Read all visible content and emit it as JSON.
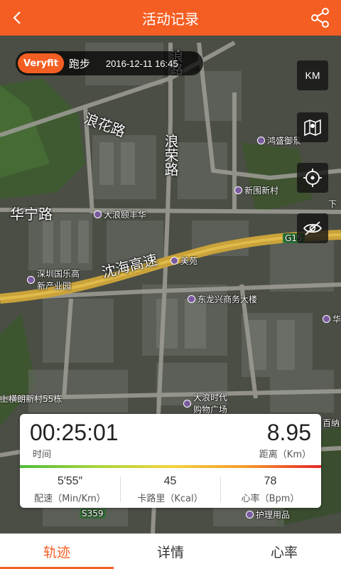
{
  "header": {
    "title": "活动记录",
    "back_icon": "back-arrow-icon",
    "share_icon": "share-icon"
  },
  "activity": {
    "brand": "Veryfit",
    "sport": "跑步",
    "datetime": "2016-12-11  16:45"
  },
  "controls": {
    "unit_label": "KM",
    "icons": [
      "map-type-icon",
      "locate-icon",
      "hide-icon"
    ]
  },
  "map": {
    "labels": {
      "road_langhua": "浪花路",
      "road_langrong": "浪荣路",
      "road_lang_top": "浪路",
      "road_huaning": "华宁路",
      "expressway": "沈海高速",
      "g15": "G15",
      "s359": "S359"
    },
    "pois": {
      "dalang_fenghua": "大浪颐丰华",
      "meiyuan": "美苑",
      "donglongxing": "东龙兴商务大楼",
      "hongsheng": "鸿盛御景",
      "xinguocun": "新围新村",
      "shenzhen_guole": "深圳国乐高新产业园",
      "shangheng": "上横朗新村55栋",
      "dalang_shidai": "大浪时代购物广场",
      "baiyou": "百纳",
      "hua": "华",
      "huli": "护理用品",
      "xia": "下"
    }
  },
  "stats": {
    "duration": "00:25:01",
    "duration_label": "时间",
    "distance": "8.95",
    "distance_label": "距离（Km）",
    "pace": "5′55″",
    "pace_label": "配速（Min/Km）",
    "calories": "45",
    "calories_label": "卡路里（Kcal）",
    "heart_rate": "78",
    "heart_rate_label": "心率（Bpm）"
  },
  "tabs": [
    {
      "label": "轨迹",
      "active": true
    },
    {
      "label": "详情",
      "active": false
    },
    {
      "label": "心率",
      "active": false
    }
  ],
  "colors": {
    "accent": "#f45e22",
    "expressway": "#c9a23a"
  }
}
